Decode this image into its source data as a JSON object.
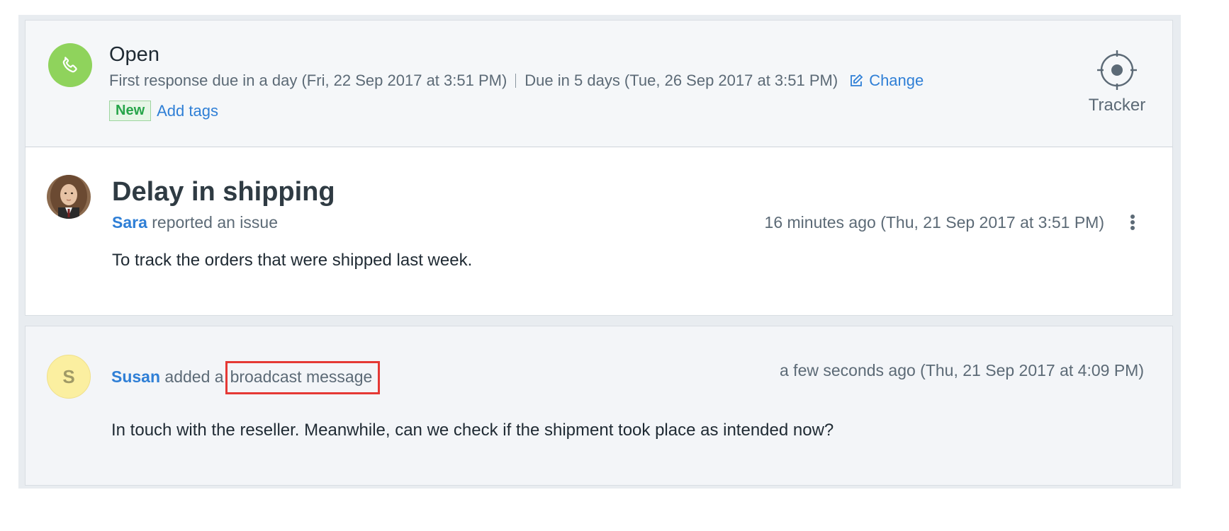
{
  "header": {
    "status": "Open",
    "first_response": "First response due in a day (Fri, 22 Sep 2017 at 3:51 PM)",
    "due": "Due in 5 days (Tue, 26 Sep 2017 at 3:51 PM)",
    "change_label": "Change",
    "badge": "New",
    "add_tags_label": "Add tags",
    "tracker_label": "Tracker",
    "status_icon": "phone-icon",
    "status_color": "#8fd35c"
  },
  "ticket": {
    "title": "Delay in shipping",
    "reporter": "Sara",
    "reporter_action": "reported an issue",
    "time": "16 minutes ago (Thu, 21 Sep 2017 at 3:51 PM)",
    "body": "To track the orders that were shipped last week."
  },
  "note": {
    "avatar_letter": "S",
    "author": "Susan",
    "action": "added a",
    "highlighted": "broadcast message",
    "time": "a few seconds ago (Thu, 21 Sep 2017 at 4:09 PM)",
    "body": "In touch with the reseller. Meanwhile, can we check if the shipment took place as intended now?"
  },
  "colors": {
    "link": "#2f7fd6",
    "highlight_border": "#e53935",
    "new_badge": "#27a54a"
  }
}
